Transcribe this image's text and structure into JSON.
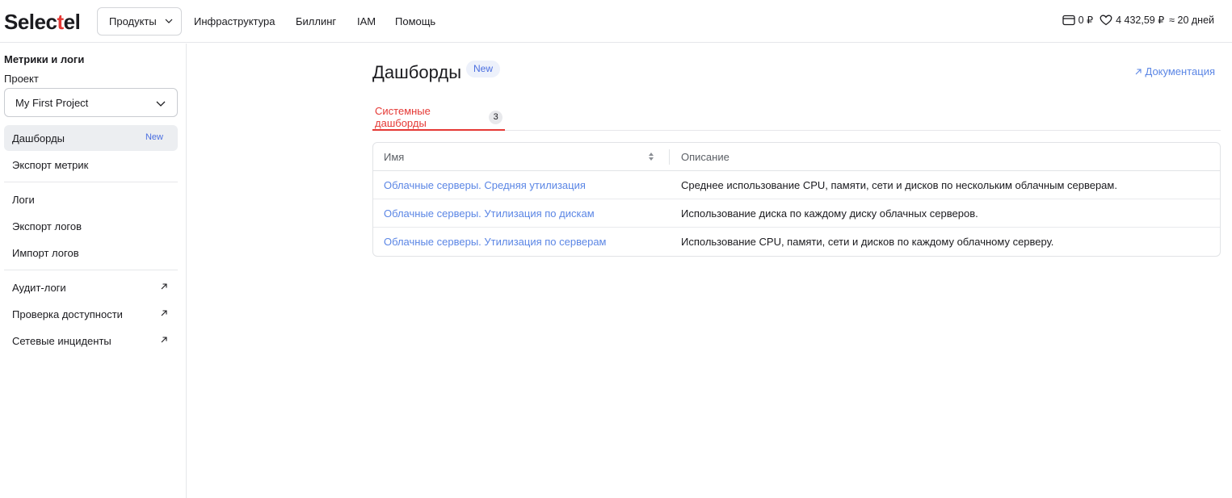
{
  "header": {
    "logo_text": "Selectel",
    "products_label": "Продукты",
    "nav": [
      "Инфраструктура",
      "Биллинг",
      "IAM",
      "Помощь"
    ],
    "wallet_amount": "0 ₽",
    "bonus_amount": "4 432,59 ₽",
    "days_left": "≈ 20 дней"
  },
  "sidebar": {
    "title": "Метрики и логи",
    "project_label": "Проект",
    "project_value": "My First Project",
    "items": [
      {
        "label": "Дашборды",
        "badge": "New"
      },
      {
        "label": "Экспорт метрик"
      },
      {
        "label": "Логи"
      },
      {
        "label": "Экспорт логов"
      },
      {
        "label": "Импорт логов"
      },
      {
        "label": "Аудит-логи"
      },
      {
        "label": "Проверка доступности"
      },
      {
        "label": "Сетевые инциденты"
      }
    ]
  },
  "main": {
    "title": "Дашборды",
    "title_badge": "New",
    "doc_link": "Документация",
    "tab_label": "Системные дашборды",
    "tab_count": "3",
    "table": {
      "columns": [
        "Имя",
        "Описание"
      ],
      "rows": [
        {
          "name": "Облачные серверы. Средняя утилизация",
          "description": "Среднее использование CPU, памяти, сети и дисков по нескольким облачным серверам."
        },
        {
          "name": "Облачные серверы. Утилизация по дискам",
          "description": "Использование диска по каждому диску облачных серверов."
        },
        {
          "name": "Облачные серверы. Утилизация по серверам",
          "description": "Использование CPU, памяти, сети и дисков по каждому облачному серверу."
        }
      ]
    }
  },
  "colors": {
    "accent": "#e53935",
    "link": "#5b86e5",
    "badge_text": "#4a6ee0"
  },
  "icons": [
    "chevron-down-icon",
    "wallet-icon",
    "heart-icon",
    "external-link-icon",
    "sort-icon"
  ]
}
